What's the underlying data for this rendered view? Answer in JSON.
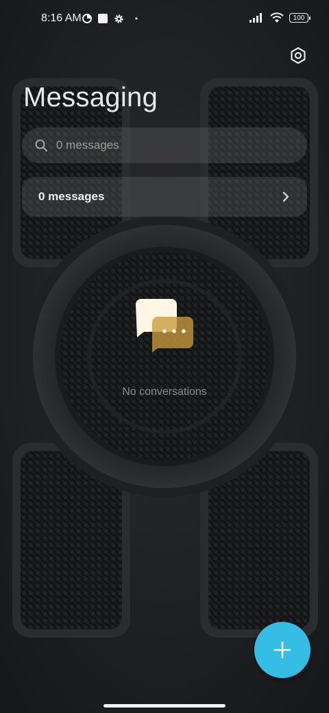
{
  "status_bar": {
    "time": "8:16 AM",
    "battery": "100",
    "left_icons": [
      "data-saver-icon",
      "square-notification-icon",
      "gear-notification-icon",
      "dot-icon"
    ],
    "right_icons": [
      "signal-icon",
      "wifi-icon",
      "battery-icon"
    ]
  },
  "header": {
    "title": "Messaging",
    "settings_icon": "hexagon-settings-icon"
  },
  "search": {
    "placeholder": "0 messages",
    "icon": "search-icon"
  },
  "messages_row": {
    "label": "0 messages",
    "icon": "chevron-right-icon"
  },
  "empty_state": {
    "text": "No conversations",
    "icon": "chat-bubbles-icon"
  },
  "fab": {
    "icon": "plus-icon",
    "color": "#35bde6"
  },
  "colors": {
    "background": "#1b1c1e",
    "accent": "#35bde6",
    "bubble_front": "#fff6e6",
    "bubble_back": "#c99a3c"
  }
}
